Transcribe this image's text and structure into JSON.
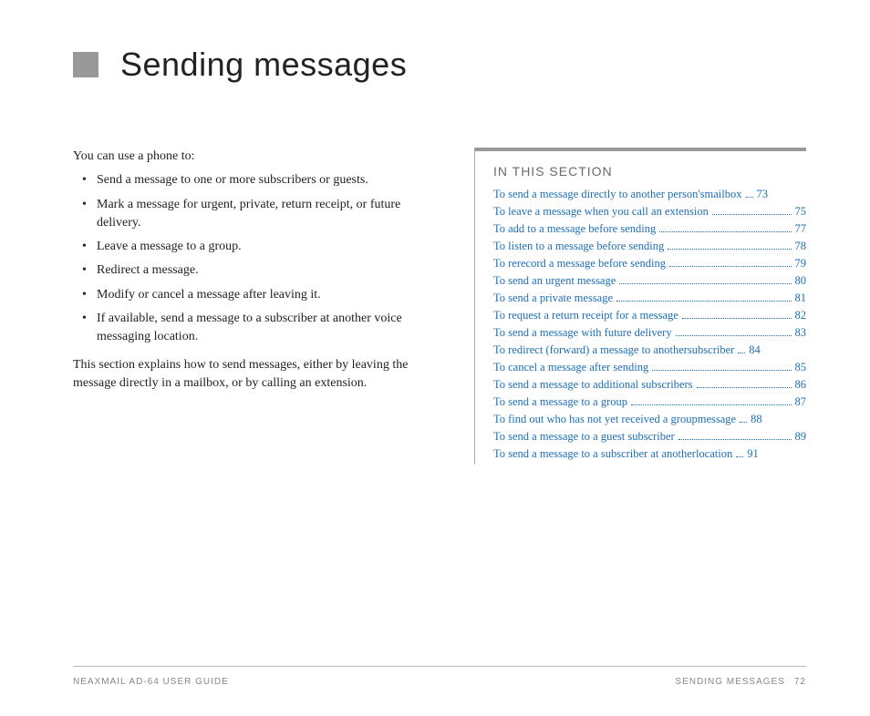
{
  "title": "Sending messages",
  "left": {
    "intro": "You can use a phone to:",
    "bullets": [
      "Send a message to one or more subscribers or guests.",
      "Mark a message for urgent, private, return receipt, or future delivery.",
      "Leave a message to a group.",
      "Redirect a message.",
      "Modify or cancel a message after leaving it.",
      "If available, send a message to a subscriber at another voice messaging location."
    ],
    "closing": "This section explains how to send messages, either by leaving the message directly in a mailbox, or by calling an extension."
  },
  "right": {
    "heading": "IN THIS SECTION",
    "toc": [
      {
        "label_a": "To send a message directly to another person's",
        "label_b": "mailbox",
        "page": "73"
      },
      {
        "label": "To leave a message when you call an extension",
        "page": "75"
      },
      {
        "label": "To add to a message before sending",
        "page": "77"
      },
      {
        "label": "To listen to a message before sending",
        "page": "78"
      },
      {
        "label": "To rerecord a message before sending",
        "page": "79"
      },
      {
        "label": "To send an urgent message",
        "page": "80"
      },
      {
        "label": "To send a private message",
        "page": "81"
      },
      {
        "label": "To request a return receipt for a message",
        "page": "82"
      },
      {
        "label": "To send a message with future delivery",
        "page": "83"
      },
      {
        "label_a": "To redirect (forward) a message to another",
        "label_b": "subscriber",
        "page": "84"
      },
      {
        "label": "To cancel a message after sending",
        "page": "85"
      },
      {
        "label": "To send a message to additional subscribers",
        "page": "86"
      },
      {
        "label": "To send a message to a group",
        "page": "87"
      },
      {
        "label_a": "To find out who has not yet received a group",
        "label_b": "message",
        "page": "88"
      },
      {
        "label": "To send a message to a guest subscriber",
        "page": "89"
      },
      {
        "label_a": "To send a message to a subscriber at another",
        "label_b": "location",
        "page": "91"
      }
    ]
  },
  "footer": {
    "left": "NEAXMAIL AD-64 USER GUIDE",
    "right_label": "SENDING MESSAGES",
    "right_page": "72"
  }
}
